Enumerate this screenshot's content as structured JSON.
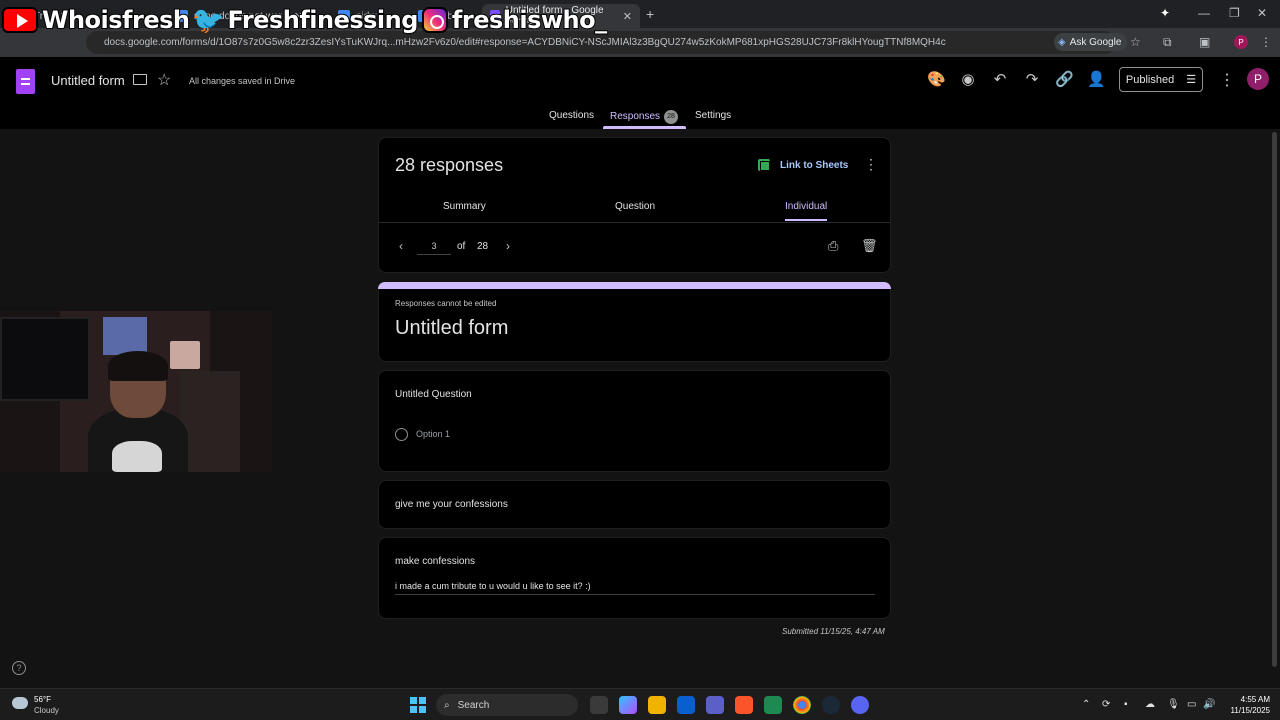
{
  "browser": {
    "tabs": [
      {
        "label": "Tril"
      },
      {
        "label": "nooo doggs not wor"
      },
      {
        "label": "oidw"
      },
      {
        "label": "nebo"
      },
      {
        "label": "Untitled form - Google Forms",
        "active": true
      }
    ],
    "url": "docs.google.com/forms/d/1O87s7z0G5w8c2zr3ZesIYsTuKWJrq...mHzw2Fv6z0/edit#response=ACYDBNiCY-NScJMIAl3z3BgQU274w5zKokMP681xpHGS28UJC73Fr8klHYougTTNf8MQH4c",
    "ask_google": "Ask Google"
  },
  "stream_overlay": {
    "youtube": "Whoisfresh",
    "twitter": "Freshfinessing",
    "instagram": "freshiswho_"
  },
  "forms_header": {
    "title": "Untitled form",
    "saved_status": "All changes saved in Drive",
    "publish_label": "Published",
    "avatar_letter": "P",
    "tabs": {
      "questions": "Questions",
      "responses": "Responses",
      "responses_count": "28",
      "settings": "Settings"
    }
  },
  "responses_card": {
    "count_label": "28 responses",
    "link_sheets": "Link to Sheets",
    "subtabs": {
      "summary": "Summary",
      "question": "Question",
      "individual": "Individual"
    },
    "current": "3",
    "of": "of",
    "total": "28"
  },
  "form_card": {
    "notice": "Responses cannot be edited",
    "title": "Untitled form"
  },
  "questions": [
    {
      "title": "Untitled Question",
      "option": "Option 1"
    },
    {
      "title": "give me your confessions"
    },
    {
      "title": "make confessions",
      "answer": "i made a cum tribute to u would u like to see it? :)"
    }
  ],
  "submitted": "Submitted 11/15/25, 4:47 AM",
  "taskbar": {
    "temp": "56°F",
    "condition": "Cloudy",
    "search": "Search",
    "time": "4:55 AM",
    "date": "11/15/2025"
  },
  "colors": {
    "accent": "#d0bcff",
    "forms_purple": "#a142f4",
    "link_blue": "#a8c7fa",
    "sheets_green": "#34a853"
  }
}
